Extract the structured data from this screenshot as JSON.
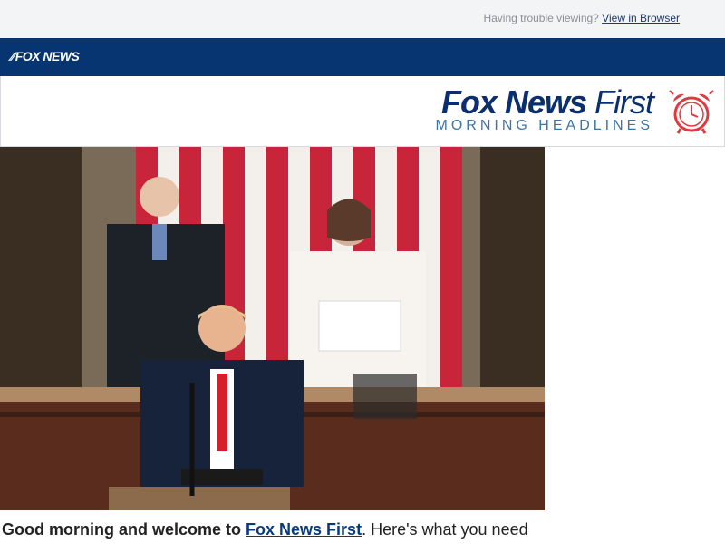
{
  "topbar": {
    "trouble_text": "Having trouble viewing?",
    "view_link": "View in Browser"
  },
  "nav": {
    "logo_text": "FOX NEWS",
    "bg_color": "#063572"
  },
  "header": {
    "brand_bold": "Fox News",
    "brand_light": "First",
    "subtitle": "MORNING HEADLINES",
    "clock_icon": "alarm-clock-icon",
    "accent_color": "#e0393e"
  },
  "hero": {
    "image_icon": "hero-photo"
  },
  "intro": {
    "lead": "Good morning and welcome to",
    "link": "Fox News First",
    "rest": ". Here's what you need"
  }
}
